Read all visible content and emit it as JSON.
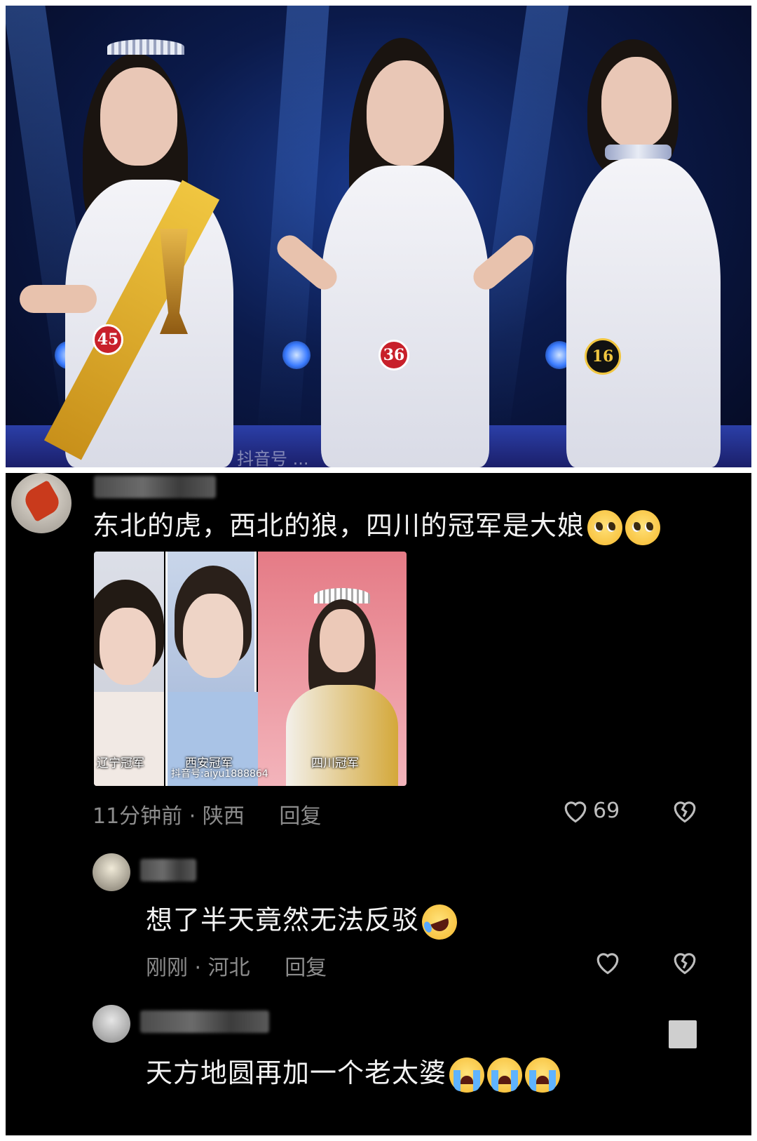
{
  "photo": {
    "contestants": [
      {
        "number": "45"
      },
      {
        "number": "36"
      },
      {
        "number": "16"
      }
    ],
    "watermark": "抖音号 ..."
  },
  "comments": [
    {
      "text": "东北的虎，西北的狼，四川的冠军是大娘",
      "emoji": [
        "pleading-face",
        "pleading-face"
      ],
      "image_captions": [
        "辽宁冠军",
        "西安冠军",
        "四川冠军"
      ],
      "image_watermark": "抖音号:aiyu1888864",
      "time": "11分钟前",
      "location": "陕西",
      "separator": "·",
      "reply_label": "回复",
      "likes": "69"
    },
    {
      "text": "想了半天竟然无法反驳",
      "emoji": [
        "rolling-laughing-face"
      ],
      "time": "刚刚",
      "location": "河北",
      "separator": "·",
      "reply_label": "回复",
      "likes": ""
    },
    {
      "text": "天方地圆再加一个老太婆",
      "emoji": [
        "loudly-crying-face",
        "loudly-crying-face",
        "loudly-crying-face"
      ]
    }
  ],
  "colors": {
    "panel_bg": "#000000",
    "meta_text": "#8c8c8c",
    "badge_red": "#c8202a",
    "badge_black": "#111111"
  }
}
